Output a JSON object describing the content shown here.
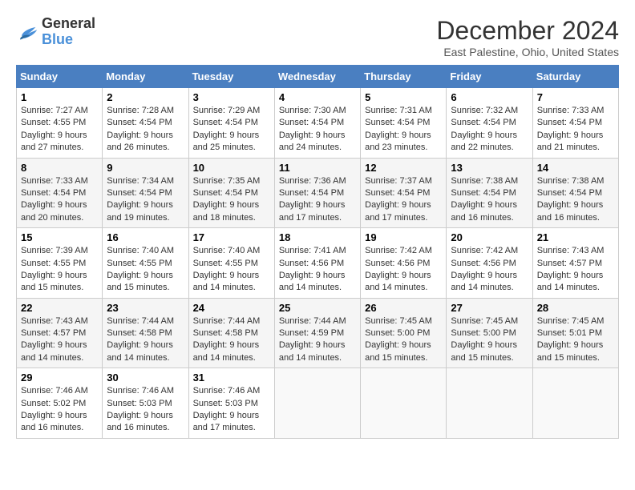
{
  "header": {
    "logo_line1": "General",
    "logo_line2": "Blue",
    "month_title": "December 2024",
    "location": "East Palestine, Ohio, United States"
  },
  "weekdays": [
    "Sunday",
    "Monday",
    "Tuesday",
    "Wednesday",
    "Thursday",
    "Friday",
    "Saturday"
  ],
  "weeks": [
    [
      {
        "day": "1",
        "sunrise": "7:27 AM",
        "sunset": "4:55 PM",
        "daylight": "9 hours and 27 minutes."
      },
      {
        "day": "2",
        "sunrise": "7:28 AM",
        "sunset": "4:54 PM",
        "daylight": "9 hours and 26 minutes."
      },
      {
        "day": "3",
        "sunrise": "7:29 AM",
        "sunset": "4:54 PM",
        "daylight": "9 hours and 25 minutes."
      },
      {
        "day": "4",
        "sunrise": "7:30 AM",
        "sunset": "4:54 PM",
        "daylight": "9 hours and 24 minutes."
      },
      {
        "day": "5",
        "sunrise": "7:31 AM",
        "sunset": "4:54 PM",
        "daylight": "9 hours and 23 minutes."
      },
      {
        "day": "6",
        "sunrise": "7:32 AM",
        "sunset": "4:54 PM",
        "daylight": "9 hours and 22 minutes."
      },
      {
        "day": "7",
        "sunrise": "7:33 AM",
        "sunset": "4:54 PM",
        "daylight": "9 hours and 21 minutes."
      }
    ],
    [
      {
        "day": "8",
        "sunrise": "7:33 AM",
        "sunset": "4:54 PM",
        "daylight": "9 hours and 20 minutes."
      },
      {
        "day": "9",
        "sunrise": "7:34 AM",
        "sunset": "4:54 PM",
        "daylight": "9 hours and 19 minutes."
      },
      {
        "day": "10",
        "sunrise": "7:35 AM",
        "sunset": "4:54 PM",
        "daylight": "9 hours and 18 minutes."
      },
      {
        "day": "11",
        "sunrise": "7:36 AM",
        "sunset": "4:54 PM",
        "daylight": "9 hours and 17 minutes."
      },
      {
        "day": "12",
        "sunrise": "7:37 AM",
        "sunset": "4:54 PM",
        "daylight": "9 hours and 17 minutes."
      },
      {
        "day": "13",
        "sunrise": "7:38 AM",
        "sunset": "4:54 PM",
        "daylight": "9 hours and 16 minutes."
      },
      {
        "day": "14",
        "sunrise": "7:38 AM",
        "sunset": "4:54 PM",
        "daylight": "9 hours and 16 minutes."
      }
    ],
    [
      {
        "day": "15",
        "sunrise": "7:39 AM",
        "sunset": "4:55 PM",
        "daylight": "9 hours and 15 minutes."
      },
      {
        "day": "16",
        "sunrise": "7:40 AM",
        "sunset": "4:55 PM",
        "daylight": "9 hours and 15 minutes."
      },
      {
        "day": "17",
        "sunrise": "7:40 AM",
        "sunset": "4:55 PM",
        "daylight": "9 hours and 14 minutes."
      },
      {
        "day": "18",
        "sunrise": "7:41 AM",
        "sunset": "4:56 PM",
        "daylight": "9 hours and 14 minutes."
      },
      {
        "day": "19",
        "sunrise": "7:42 AM",
        "sunset": "4:56 PM",
        "daylight": "9 hours and 14 minutes."
      },
      {
        "day": "20",
        "sunrise": "7:42 AM",
        "sunset": "4:56 PM",
        "daylight": "9 hours and 14 minutes."
      },
      {
        "day": "21",
        "sunrise": "7:43 AM",
        "sunset": "4:57 PM",
        "daylight": "9 hours and 14 minutes."
      }
    ],
    [
      {
        "day": "22",
        "sunrise": "7:43 AM",
        "sunset": "4:57 PM",
        "daylight": "9 hours and 14 minutes."
      },
      {
        "day": "23",
        "sunrise": "7:44 AM",
        "sunset": "4:58 PM",
        "daylight": "9 hours and 14 minutes."
      },
      {
        "day": "24",
        "sunrise": "7:44 AM",
        "sunset": "4:58 PM",
        "daylight": "9 hours and 14 minutes."
      },
      {
        "day": "25",
        "sunrise": "7:44 AM",
        "sunset": "4:59 PM",
        "daylight": "9 hours and 14 minutes."
      },
      {
        "day": "26",
        "sunrise": "7:45 AM",
        "sunset": "5:00 PM",
        "daylight": "9 hours and 15 minutes."
      },
      {
        "day": "27",
        "sunrise": "7:45 AM",
        "sunset": "5:00 PM",
        "daylight": "9 hours and 15 minutes."
      },
      {
        "day": "28",
        "sunrise": "7:45 AM",
        "sunset": "5:01 PM",
        "daylight": "9 hours and 15 minutes."
      }
    ],
    [
      {
        "day": "29",
        "sunrise": "7:46 AM",
        "sunset": "5:02 PM",
        "daylight": "9 hours and 16 minutes."
      },
      {
        "day": "30",
        "sunrise": "7:46 AM",
        "sunset": "5:03 PM",
        "daylight": "9 hours and 16 minutes."
      },
      {
        "day": "31",
        "sunrise": "7:46 AM",
        "sunset": "5:03 PM",
        "daylight": "9 hours and 17 minutes."
      },
      null,
      null,
      null,
      null
    ]
  ]
}
